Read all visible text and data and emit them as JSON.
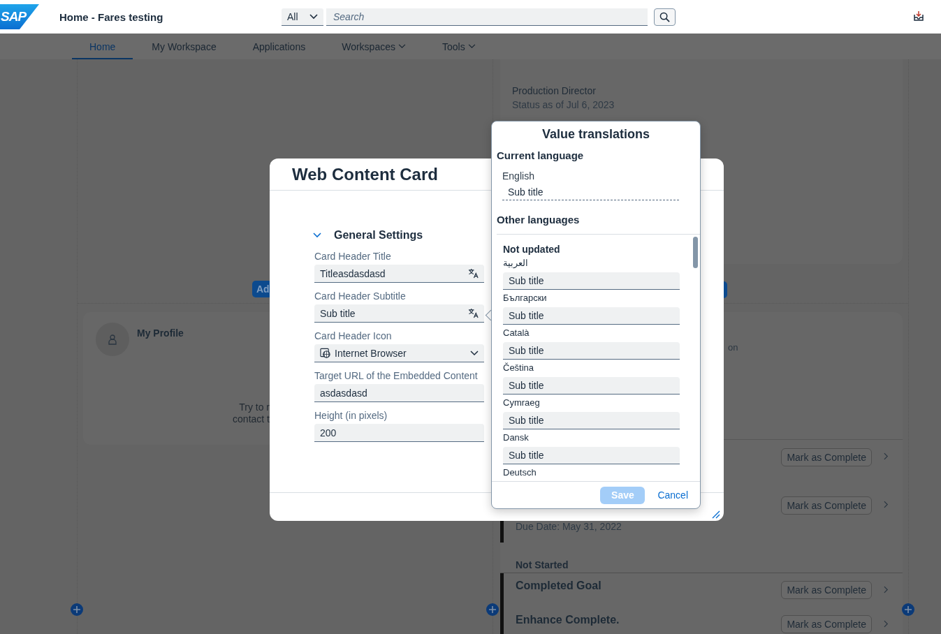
{
  "header": {
    "logo": "SAP",
    "title": "Home - Fares testing",
    "search_scope": "All",
    "search_placeholder": "Search"
  },
  "nav": [
    {
      "label": "Home",
      "selected": true,
      "dropdown": false
    },
    {
      "label": "My Workspace",
      "selected": false,
      "dropdown": false
    },
    {
      "label": "Applications",
      "selected": false,
      "dropdown": false
    },
    {
      "label": "Workspaces",
      "selected": false,
      "dropdown": true
    },
    {
      "label": "Tools",
      "selected": false,
      "dropdown": true
    }
  ],
  "background": {
    "left": {
      "add_button": "Ad",
      "profile_card": {
        "title": "My Profile",
        "message_lines": [
          "Try to r",
          "contact t"
        ]
      }
    },
    "right": {
      "status_card": {
        "role": "Production Director",
        "status": "Status as of Jul 6, 2023"
      },
      "goals_card": {
        "fragment": "on",
        "rows": [
          {
            "kind": "action",
            "button": "Mark as Complete"
          },
          {
            "kind": "action",
            "button": "Mark as Complete",
            "due": "Due Date: May 31, 2022"
          },
          {
            "kind": "group",
            "label": "Not Started"
          },
          {
            "kind": "goal",
            "title": "Completed Goal",
            "button": "Mark as Complete"
          },
          {
            "kind": "goal",
            "title": "Enhance Complete.",
            "button": "Mark as Complete"
          }
        ]
      }
    }
  },
  "dialog": {
    "title": "Web Content Card",
    "section": {
      "title": "General Settings",
      "expanded": true
    },
    "fields": [
      {
        "label": "Card Header Title",
        "value": "Titleasdasdasd",
        "kind": "translatable"
      },
      {
        "label": "Card Header Subtitle",
        "value": "Sub title",
        "kind": "translatable"
      },
      {
        "label": "Card Header Icon",
        "value": "Internet Browser",
        "kind": "select"
      },
      {
        "label": "Target URL of the Embedded Content",
        "value": "asdasdasd",
        "kind": "text"
      },
      {
        "label": "Height (in pixels)",
        "value": "200",
        "kind": "text"
      }
    ]
  },
  "popover": {
    "title": "Value translations",
    "current_heading": "Current language",
    "current_language": "English",
    "current_value": "Sub title",
    "other_heading": "Other languages",
    "group_heading": "Not updated",
    "languages": [
      {
        "name": "العربية",
        "value": "Sub title"
      },
      {
        "name": "Български",
        "value": "Sub title"
      },
      {
        "name": "Català",
        "value": "Sub title"
      },
      {
        "name": "Čeština",
        "value": "Sub title"
      },
      {
        "name": "Cymraeg",
        "value": "Sub title"
      },
      {
        "name": "Dansk",
        "value": "Sub title"
      },
      {
        "name": "Deutsch"
      }
    ],
    "save": {
      "label": "Save",
      "disabled": true
    },
    "cancel": "Cancel"
  }
}
